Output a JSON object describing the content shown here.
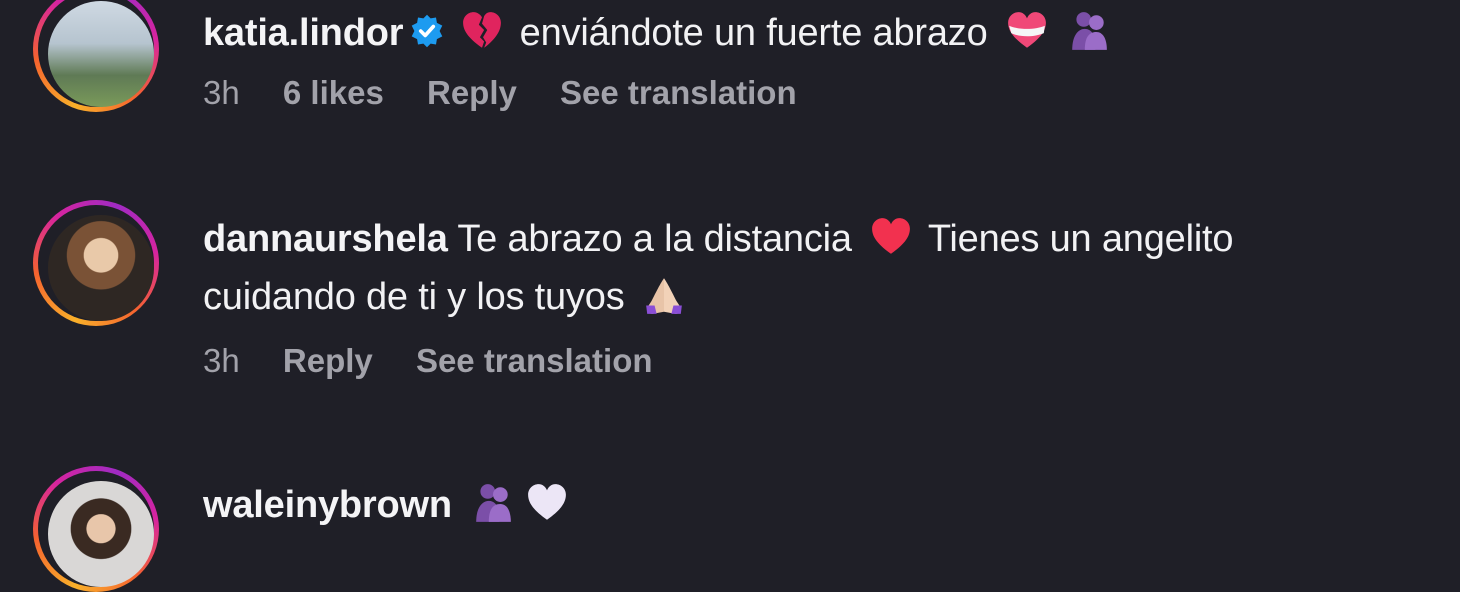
{
  "comments": [
    {
      "username": "katia.lindor",
      "verified": true,
      "text_parts": [
        "",
        "enviándote un fuerte abrazo"
      ],
      "emojis": [
        "broken-heart-icon",
        "heart-with-ribbon-icon",
        "people-hugging-icon"
      ],
      "time": "3h",
      "likes": "6 likes",
      "reply": "Reply",
      "translate": "See translation"
    },
    {
      "username": "dannaurshela",
      "verified": false,
      "text_line1a": "Te abrazo a la distancia",
      "text_line1b": "Tienes un angelito",
      "text_line2": "cuidando de ti y los tuyos",
      "emojis": [
        "red-heart-icon",
        "folded-hands-icon"
      ],
      "time": "3h",
      "reply": "Reply",
      "translate": "See translation"
    },
    {
      "username": "waleinybrown",
      "verified": false,
      "emojis": [
        "people-hugging-icon",
        "white-heart-icon"
      ]
    }
  ],
  "colors": {
    "background": "#1f1f27",
    "verified_badge": "#1d9bf0",
    "meta_text": "#a2a2aa"
  }
}
